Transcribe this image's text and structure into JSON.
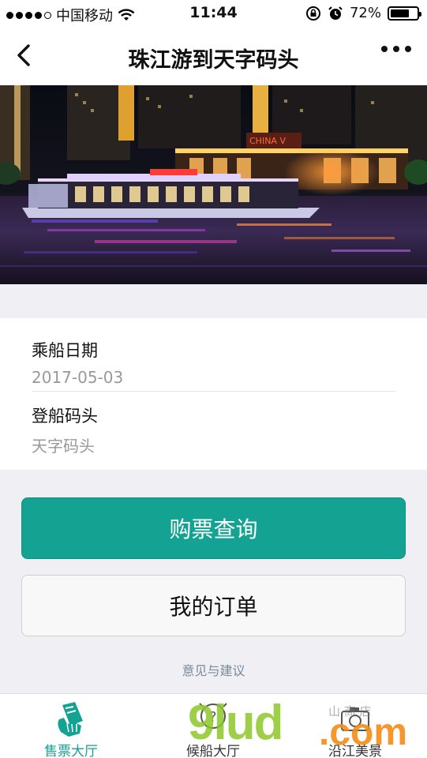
{
  "status_bar": {
    "carrier": "中国移动",
    "time": "11:44",
    "battery_text": "72%",
    "battery_level": 0.72,
    "icons": [
      "wifi-icon",
      "rotation-lock-icon",
      "alarm-icon",
      "battery-icon"
    ]
  },
  "nav": {
    "title": "珠江游到天字码头",
    "back_icon": "chevron-left-icon",
    "more_icon": "more-dots-icon"
  },
  "form": {
    "date_label": "乘船日期",
    "date_value": "2017-05-03",
    "pier_label": "登船码头",
    "pier_value": "天字码头"
  },
  "buttons": {
    "query": "购票查询",
    "orders": "我的订单"
  },
  "feedback": "意见与建议",
  "tabs": [
    {
      "label": "售票大厅",
      "icon": "ticket-hand-icon",
      "active": true
    },
    {
      "label": "候船大厅",
      "icon": "waiting-hall-icon",
      "active": false
    },
    {
      "label": "沿江美景",
      "icon": "camera-icon",
      "active": false
    }
  ],
  "watermark": {
    "main": "9lud",
    "suffix": ".com",
    "small": "山 商 店"
  },
  "colors": {
    "accent": "#14a393",
    "background": "#efeff4",
    "muted_text": "#999999"
  }
}
